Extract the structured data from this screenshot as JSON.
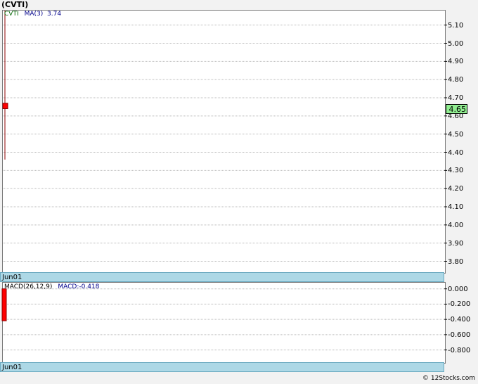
{
  "title": "(CVTI)",
  "legend": {
    "symbol": "CVTI",
    "ma_label": "MA(3)",
    "ma_value": "3.74",
    "macd_label": "MACD(26,12,9)",
    "macd_value": "MACD:-0.418"
  },
  "price_badge": "4.65",
  "date_label_1": "Jun01",
  "date_label_2": "Jun01",
  "credit": "© 12Stocks.com",
  "colors": {
    "candle": "#ff0000",
    "wick": "#8b0000",
    "macd_bar": "#ff0000",
    "grid": "#bbbbbb",
    "date_bar": "#add8e6",
    "price_badge": "#90ee90"
  },
  "chart_data": [
    {
      "type": "candlestick",
      "title": "(CVTI)",
      "price_ticks": [
        "5.10",
        "5.00",
        "4.90",
        "4.80",
        "4.70",
        "4.60",
        "4.50",
        "4.40",
        "4.30",
        "4.20",
        "4.10",
        "4.00",
        "3.90",
        "3.80"
      ],
      "ylim": [
        3.74,
        5.18
      ],
      "x": [
        "Jun01"
      ],
      "ohlc": [
        {
          "open": 4.67,
          "high": 5.18,
          "low": 4.36,
          "close": 4.64
        }
      ],
      "grid": true,
      "legend": [
        "CVTI",
        "MA(3) 3.74"
      ]
    },
    {
      "type": "bar",
      "title": "MACD(26,12,9)",
      "macd_ticks": [
        "0.000",
        "-0.200",
        "-0.400",
        "-0.600",
        "-0.800"
      ],
      "ylim": [
        -0.96,
        0.08
      ],
      "x": [
        "Jun01"
      ],
      "values": [
        -0.418
      ],
      "grid": true
    }
  ]
}
